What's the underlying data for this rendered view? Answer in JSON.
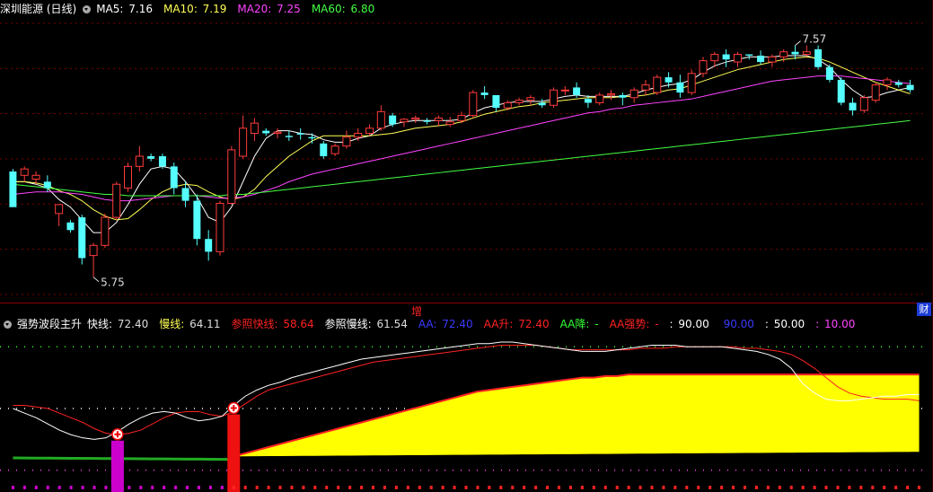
{
  "main_header": {
    "title": "深圳能源 (日线)",
    "items": [
      {
        "label": "MA5:",
        "value": "7.16",
        "color": "#ffffff"
      },
      {
        "label": "MA10:",
        "value": "7.19",
        "color": "#ffff55"
      },
      {
        "label": "MA20:",
        "value": "7.25",
        "color": "#ff44ff"
      },
      {
        "label": "MA60:",
        "value": "6.80",
        "color": "#44ff44"
      }
    ]
  },
  "price_annotations": {
    "high": "7.57",
    "low": "5.75"
  },
  "mid_marker": "增",
  "corner_button": "财",
  "indicator_header": {
    "title": "强势波段主升",
    "items": [
      {
        "label": "快线:",
        "value": "72.40",
        "label_color": "#ffffff",
        "value_color": "#dddddd"
      },
      {
        "label": "慢线:",
        "value": "64.11",
        "label_color": "#ffff55",
        "value_color": "#dddddd"
      },
      {
        "label": "参照快线:",
        "value": "58.64",
        "label_color": "#ff2222",
        "value_color": "#ff2222"
      },
      {
        "label": "参照慢线:",
        "value": "61.54",
        "label_color": "#ffffff",
        "value_color": "#dddddd"
      },
      {
        "label": "AA:",
        "value": "72.40",
        "label_color": "#3a3aff",
        "value_color": "#3a3aff"
      },
      {
        "label": "AA升:",
        "value": "72.40",
        "label_color": "#ff2222",
        "value_color": "#ff2222"
      },
      {
        "label": "AA降:",
        "value": "-",
        "label_color": "#33ff33",
        "value_color": "#33ff33"
      },
      {
        "label": "AA强势:",
        "value": "-",
        "label_color": "#ff2222",
        "value_color": "#ff2222"
      },
      {
        "label": ":",
        "value": "90.00",
        "label_color": "#ffffff",
        "value_color": "#ffffff"
      },
      {
        "label": "",
        "value": "90.00",
        "label_color": "#3a3aff",
        "value_color": "#3a3aff"
      },
      {
        "label": ":",
        "value": "50.00",
        "label_color": "#ffffff",
        "value_color": "#ffffff"
      },
      {
        "label": ":",
        "value": "10.00",
        "label_color": "#ff44ff",
        "value_color": "#ff44ff"
      }
    ]
  },
  "chart_data": [
    {
      "type": "candlestick",
      "title": "深圳能源 (日线)",
      "ylim": [
        5.6,
        7.8
      ],
      "annotations": [
        {
          "text": "7.57",
          "at": "high"
        },
        {
          "text": "5.75",
          "at": "low"
        }
      ],
      "candles": [
        [
          6.58,
          6.6,
          6.32,
          6.3
        ],
        [
          6.55,
          6.62,
          6.5,
          6.6
        ],
        [
          6.52,
          6.58,
          6.48,
          6.55
        ],
        [
          6.5,
          6.55,
          6.42,
          6.45
        ],
        [
          6.25,
          6.3,
          6.15,
          6.32
        ],
        [
          6.18,
          6.2,
          6.1,
          6.12
        ],
        [
          6.22,
          6.24,
          5.85,
          5.9
        ],
        [
          5.92,
          6.02,
          5.75,
          6.0
        ],
        [
          6.0,
          6.25,
          5.98,
          6.22
        ],
        [
          6.22,
          6.5,
          6.2,
          6.48
        ],
        [
          6.45,
          6.65,
          6.42,
          6.62
        ],
        [
          6.62,
          6.78,
          6.58,
          6.7
        ],
        [
          6.7,
          6.72,
          6.66,
          6.68
        ],
        [
          6.7,
          6.72,
          6.6,
          6.62
        ],
        [
          6.62,
          6.65,
          6.4,
          6.45
        ],
        [
          6.45,
          6.5,
          6.3,
          6.35
        ],
        [
          6.35,
          6.4,
          6.0,
          6.05
        ],
        [
          6.05,
          6.12,
          5.88,
          5.95
        ],
        [
          5.95,
          6.35,
          5.92,
          6.33
        ],
        [
          6.33,
          6.78,
          6.32,
          6.75
        ],
        [
          6.7,
          7.02,
          6.68,
          6.92
        ],
        [
          6.88,
          7.0,
          6.82,
          6.96
        ],
        [
          6.9,
          6.92,
          6.86,
          6.88
        ],
        [
          6.88,
          6.92,
          6.84,
          6.89
        ],
        [
          6.86,
          6.9,
          6.82,
          6.85
        ],
        [
          6.88,
          6.92,
          6.83,
          6.87
        ],
        [
          6.85,
          6.88,
          6.8,
          6.84
        ],
        [
          6.8,
          6.82,
          6.68,
          6.7
        ],
        [
          6.72,
          6.8,
          6.7,
          6.78
        ],
        [
          6.78,
          6.9,
          6.76,
          6.85
        ],
        [
          6.85,
          6.92,
          6.82,
          6.88
        ],
        [
          6.88,
          6.95,
          6.86,
          6.92
        ],
        [
          6.92,
          7.1,
          6.9,
          7.05
        ],
        [
          7.02,
          7.04,
          6.93,
          6.95
        ],
        [
          6.97,
          7.0,
          6.93,
          6.99
        ],
        [
          6.99,
          7.02,
          6.96,
          7.0
        ],
        [
          6.98,
          7.0,
          6.95,
          6.97
        ],
        [
          6.98,
          7.02,
          6.94,
          7.0
        ],
        [
          6.95,
          7.01,
          6.93,
          6.97
        ],
        [
          6.98,
          7.05,
          6.96,
          7.02
        ],
        [
          7.02,
          7.22,
          7.0,
          7.2
        ],
        [
          7.2,
          7.25,
          7.15,
          7.18
        ],
        [
          7.18,
          7.15,
          7.05,
          7.08
        ],
        [
          7.08,
          7.14,
          7.06,
          7.12
        ],
        [
          7.12,
          7.16,
          7.1,
          7.14
        ],
        [
          7.14,
          7.18,
          7.1,
          7.16
        ],
        [
          7.12,
          7.15,
          7.08,
          7.1
        ],
        [
          7.1,
          7.24,
          7.08,
          7.22
        ],
        [
          7.22,
          7.25,
          7.18,
          7.22
        ],
        [
          7.24,
          7.28,
          7.16,
          7.18
        ],
        [
          7.15,
          7.18,
          7.08,
          7.12
        ],
        [
          7.12,
          7.2,
          7.1,
          7.18
        ],
        [
          7.18,
          7.22,
          7.14,
          7.19
        ],
        [
          7.18,
          7.2,
          7.1,
          7.16
        ],
        [
          7.16,
          7.24,
          7.12,
          7.22
        ],
        [
          7.22,
          7.3,
          7.18,
          7.26
        ],
        [
          7.2,
          7.34,
          7.18,
          7.32
        ],
        [
          7.32,
          7.36,
          7.24,
          7.28
        ],
        [
          7.28,
          7.34,
          7.16,
          7.2
        ],
        [
          7.2,
          7.38,
          7.18,
          7.35
        ],
        [
          7.35,
          7.48,
          7.32,
          7.45
        ],
        [
          7.45,
          7.52,
          7.4,
          7.5
        ],
        [
          7.5,
          7.54,
          7.4,
          7.46
        ],
        [
          7.44,
          7.52,
          7.4,
          7.5
        ],
        [
          7.5,
          7.5,
          7.46,
          7.49
        ],
        [
          7.49,
          7.53,
          7.42,
          7.44
        ],
        [
          7.44,
          7.5,
          7.4,
          7.48
        ],
        [
          7.48,
          7.54,
          7.44,
          7.52
        ],
        [
          7.52,
          7.57,
          7.46,
          7.5
        ],
        [
          7.5,
          7.57,
          7.48,
          7.52
        ],
        [
          7.54,
          7.57,
          7.38,
          7.4
        ],
        [
          7.4,
          7.42,
          7.28,
          7.3
        ],
        [
          7.3,
          7.32,
          7.1,
          7.12
        ],
        [
          7.12,
          7.16,
          7.02,
          7.06
        ],
        [
          7.06,
          7.18,
          7.04,
          7.16
        ],
        [
          7.14,
          7.28,
          7.12,
          7.26
        ],
        [
          7.26,
          7.32,
          7.22,
          7.3
        ],
        [
          7.28,
          7.3,
          7.24,
          7.26
        ],
        [
          7.26,
          7.3,
          7.2,
          7.22
        ]
      ],
      "series": [
        {
          "name": "MA5",
          "color": "#ffffff",
          "values": [
            6.5,
            6.5,
            6.48,
            6.45,
            6.36,
            6.3,
            6.2,
            6.1,
            6.1,
            6.18,
            6.32,
            6.48,
            6.6,
            6.62,
            6.6,
            6.5,
            6.38,
            6.22,
            6.18,
            6.3,
            6.5,
            6.7,
            6.84,
            6.9,
            6.9,
            6.88,
            6.87,
            6.83,
            6.81,
            6.81,
            6.84,
            6.86,
            6.92,
            6.95,
            6.97,
            6.98,
            6.98,
            6.98,
            6.98,
            6.99,
            7.04,
            7.08,
            7.1,
            7.12,
            7.13,
            7.13,
            7.13,
            7.15,
            7.17,
            7.18,
            7.17,
            7.17,
            7.17,
            7.17,
            7.19,
            7.22,
            7.24,
            7.26,
            7.27,
            7.3,
            7.36,
            7.41,
            7.44,
            7.46,
            7.48,
            7.48,
            7.48,
            7.49,
            7.49,
            7.49,
            7.46,
            7.4,
            7.3,
            7.22,
            7.16,
            7.17,
            7.2,
            7.22,
            7.24
          ]
        },
        {
          "name": "MA10",
          "color": "#ffff55",
          "values": [
            6.5,
            6.5,
            6.49,
            6.47,
            6.43,
            6.4,
            6.35,
            6.28,
            6.23,
            6.2,
            6.21,
            6.28,
            6.36,
            6.42,
            6.46,
            6.48,
            6.47,
            6.42,
            6.38,
            6.36,
            6.38,
            6.44,
            6.54,
            6.62,
            6.7,
            6.76,
            6.82,
            6.86,
            6.86,
            6.86,
            6.86,
            6.86,
            6.87,
            6.88,
            6.9,
            6.92,
            6.93,
            6.94,
            6.95,
            6.97,
            7.0,
            7.03,
            7.05,
            7.07,
            7.09,
            7.1,
            7.12,
            7.13,
            7.14,
            7.15,
            7.16,
            7.16,
            7.16,
            7.17,
            7.17,
            7.18,
            7.2,
            7.22,
            7.23,
            7.26,
            7.29,
            7.32,
            7.35,
            7.38,
            7.4,
            7.42,
            7.44,
            7.46,
            7.47,
            7.48,
            7.47,
            7.44,
            7.4,
            7.36,
            7.32,
            7.28,
            7.25,
            7.22,
            7.19
          ]
        },
        {
          "name": "MA20",
          "color": "#ff44ff",
          "values": [
            6.4,
            6.41,
            6.42,
            6.42,
            6.42,
            6.41,
            6.4,
            6.38,
            6.36,
            6.35,
            6.35,
            6.36,
            6.37,
            6.38,
            6.39,
            6.39,
            6.39,
            6.38,
            6.37,
            6.37,
            6.38,
            6.4,
            6.43,
            6.46,
            6.5,
            6.53,
            6.56,
            6.58,
            6.6,
            6.62,
            6.64,
            6.66,
            6.68,
            6.7,
            6.72,
            6.74,
            6.76,
            6.78,
            6.8,
            6.82,
            6.84,
            6.86,
            6.88,
            6.9,
            6.92,
            6.94,
            6.96,
            6.98,
            7.0,
            7.02,
            7.04,
            7.05,
            7.07,
            7.08,
            7.1,
            7.11,
            7.12,
            7.13,
            7.14,
            7.15,
            7.17,
            7.19,
            7.21,
            7.23,
            7.25,
            7.27,
            7.29,
            7.3,
            7.31,
            7.32,
            7.33,
            7.33,
            7.33,
            7.32,
            7.31,
            7.3,
            7.29,
            7.28,
            7.27
          ]
        },
        {
          "name": "MA60",
          "color": "#44ff44",
          "values": [
            6.48,
            6.47,
            6.46,
            6.45,
            6.44,
            6.43,
            6.42,
            6.41,
            6.4,
            6.4,
            6.39,
            6.39,
            6.39,
            6.39,
            6.39,
            6.39,
            6.39,
            6.39,
            6.39,
            6.4,
            6.4,
            6.41,
            6.42,
            6.43,
            6.44,
            6.45,
            6.46,
            6.47,
            6.48,
            6.49,
            6.5,
            6.51,
            6.52,
            6.53,
            6.54,
            6.55,
            6.56,
            6.57,
            6.58,
            6.59,
            6.6,
            6.61,
            6.62,
            6.63,
            6.64,
            6.65,
            6.66,
            6.67,
            6.68,
            6.69,
            6.7,
            6.71,
            6.72,
            6.73,
            6.74,
            6.75,
            6.76,
            6.77,
            6.78,
            6.79,
            6.8,
            6.81,
            6.82,
            6.83,
            6.84,
            6.85,
            6.86,
            6.87,
            6.88,
            6.89,
            6.9,
            6.91,
            6.92,
            6.93,
            6.94,
            6.95,
            6.96,
            6.97,
            6.98
          ]
        }
      ]
    },
    {
      "type": "line",
      "title": "强势波段主升",
      "ylim": [
        0,
        100
      ],
      "reference_levels": [
        90,
        50,
        10
      ],
      "series": [
        {
          "name": "快线",
          "color": "#ffffff",
          "values": [
            50,
            47,
            44,
            40,
            36,
            33,
            31,
            30,
            31,
            35,
            40,
            44,
            47,
            48,
            47,
            44,
            42,
            43,
            45,
            52,
            58,
            62,
            65,
            67,
            70,
            72,
            74,
            76,
            78,
            80,
            82,
            83,
            84,
            85,
            86,
            87,
            88,
            89,
            90,
            91,
            92,
            92,
            93,
            93,
            92,
            91,
            90,
            89,
            88,
            87,
            87,
            87,
            88,
            89,
            90,
            91,
            91,
            91,
            90,
            90,
            90,
            90,
            89,
            88,
            87,
            85,
            82,
            76,
            66,
            60,
            56,
            55,
            55,
            56,
            57,
            58,
            58,
            59,
            59
          ]
        },
        {
          "name": "慢线",
          "color": "#ff2222",
          "values": [
            52,
            52,
            51,
            50,
            47,
            44,
            41,
            37,
            34,
            33,
            34,
            36,
            40,
            44,
            47,
            48,
            48,
            46,
            45,
            48,
            53,
            58,
            62,
            64,
            66,
            68,
            70,
            72,
            74,
            76,
            78,
            80,
            81,
            82,
            83,
            84,
            85,
            86,
            87,
            88,
            89,
            90,
            91,
            91,
            91,
            91,
            90,
            89,
            88,
            88,
            88,
            88,
            88,
            88,
            89,
            89,
            89,
            90,
            90,
            90,
            90,
            90,
            90,
            89,
            89,
            88,
            87,
            85,
            81,
            76,
            70,
            64,
            60,
            58,
            57,
            56,
            56,
            56,
            55
          ]
        },
        {
          "name": "AA",
          "color": "#ffff00",
          "values": [
            null,
            null,
            null,
            null,
            null,
            null,
            null,
            null,
            null,
            null,
            null,
            null,
            null,
            null,
            null,
            null,
            null,
            null,
            null,
            19,
            21,
            23,
            25,
            27,
            29,
            31,
            33,
            35,
            37,
            39,
            41,
            43,
            45,
            47,
            49,
            51,
            53,
            55,
            57,
            59,
            61,
            62,
            63,
            64,
            65,
            66,
            67,
            68,
            69,
            70,
            70,
            71,
            71,
            72,
            72,
            72,
            72,
            72,
            72,
            72,
            72,
            72,
            72,
            72,
            72,
            72,
            72,
            72,
            72,
            72,
            72,
            72,
            72,
            72,
            72,
            72,
            72,
            72,
            72
          ]
        }
      ],
      "signals": [
        {
          "index": 9,
          "type": "buy"
        },
        {
          "index": 19,
          "type": "buy"
        }
      ]
    }
  ]
}
